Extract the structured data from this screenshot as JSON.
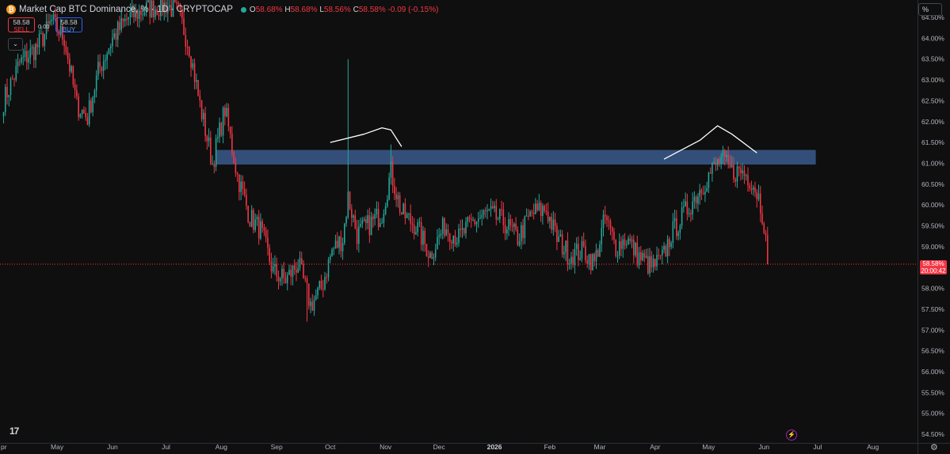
{
  "legend": {
    "coin_icon": "bitcoin-icon",
    "title": "Market Cap BTC Dominance, % · 1D · CRYPTOCAP",
    "open_label": "O",
    "open": "58.68%",
    "high_label": "H",
    "high": "58.68%",
    "low_label": "L",
    "low": "58.56%",
    "close_label": "C",
    "close": "58.58%",
    "change": "-0.09 (-0.15%)"
  },
  "trade": {
    "sell_price": "58.58",
    "sell_label": "SELL",
    "spread": "0.00",
    "buy_price": "58.58",
    "buy_label": "BUY"
  },
  "scale_button": "%",
  "last_price": {
    "value": "58.58%",
    "countdown": "20:00:42"
  },
  "colors": {
    "up": "#26a69a",
    "down": "#f23645",
    "zone": "#3a5a8c",
    "background": "#0f0f0f"
  },
  "chart_data": {
    "type": "candlestick",
    "title": "Market Cap BTC Dominance, % · 1D · CRYPTOCAP",
    "ylim": [
      54.3,
      64.5
    ],
    "y_ticks": [
      "54.50%",
      "55.00%",
      "55.50%",
      "56.00%",
      "56.50%",
      "57.00%",
      "57.50%",
      "58.00%",
      "58.50%",
      "59.00%",
      "59.50%",
      "60.00%",
      "60.50%",
      "61.00%",
      "61.50%",
      "62.00%",
      "62.50%",
      "63.00%",
      "63.50%",
      "64.00%",
      "64.50%"
    ],
    "x_ticks": [
      "pr",
      "May",
      "Jun",
      "Jul",
      "Aug",
      "Sep",
      "Oct",
      "Nov",
      "Dec",
      "2026",
      "Feb",
      "Mar",
      "Apr",
      "May",
      "Jun",
      "Jul",
      "Aug"
    ],
    "x_range": [
      "2025-03-30",
      "2026-08-26"
    ],
    "series": [
      {
        "values": [
          {
            "date": "2025-04-01",
            "close": 62.5
          },
          {
            "date": "2025-04-10",
            "close": 63.4
          },
          {
            "date": "2025-04-20",
            "close": 63.8
          },
          {
            "date": "2025-04-28",
            "close": 64.4
          },
          {
            "date": "2025-05-05",
            "close": 64.0
          },
          {
            "date": "2025-05-12",
            "close": 62.4
          },
          {
            "date": "2025-05-18",
            "close": 62.1
          },
          {
            "date": "2025-05-24",
            "close": 63.2
          },
          {
            "date": "2025-06-01",
            "close": 64.0
          },
          {
            "date": "2025-06-10",
            "close": 64.5
          },
          {
            "date": "2025-06-20",
            "close": 64.7
          },
          {
            "date": "2025-07-01",
            "close": 64.8
          },
          {
            "date": "2025-07-08",
            "close": 64.6
          },
          {
            "date": "2025-07-14",
            "close": 63.8
          },
          {
            "date": "2025-07-20",
            "close": 62.4
          },
          {
            "date": "2025-07-27",
            "close": 61.0
          },
          {
            "date": "2025-08-03",
            "close": 62.3
          },
          {
            "date": "2025-08-10",
            "close": 60.7
          },
          {
            "date": "2025-08-17",
            "close": 59.7
          },
          {
            "date": "2025-08-23",
            "close": 59.4
          },
          {
            "date": "2025-08-30",
            "close": 58.4
          },
          {
            "date": "2025-09-06",
            "close": 58.2
          },
          {
            "date": "2025-09-13",
            "close": 58.6
          },
          {
            "date": "2025-09-20",
            "close": 57.6
          },
          {
            "date": "2025-09-26",
            "close": 58.0
          },
          {
            "date": "2025-10-02",
            "close": 58.9
          },
          {
            "date": "2025-10-08",
            "close": 59.2
          },
          {
            "date": "2025-10-11",
            "close": 60.2
          },
          {
            "date": "2025-10-16",
            "close": 59.3
          },
          {
            "date": "2025-10-22",
            "close": 59.5
          },
          {
            "date": "2025-10-30",
            "close": 59.8
          },
          {
            "date": "2025-11-04",
            "close": 60.8
          },
          {
            "date": "2025-11-10",
            "close": 59.8
          },
          {
            "date": "2025-11-18",
            "close": 59.5
          },
          {
            "date": "2025-11-26",
            "close": 58.8
          },
          {
            "date": "2025-12-04",
            "close": 59.5
          },
          {
            "date": "2025-12-12",
            "close": 59.2
          },
          {
            "date": "2025-12-20",
            "close": 59.6
          },
          {
            "date": "2025-12-28",
            "close": 59.8
          },
          {
            "date": "2026-01-06",
            "close": 59.6
          },
          {
            "date": "2026-01-14",
            "close": 59.2
          },
          {
            "date": "2026-01-22",
            "close": 59.8
          },
          {
            "date": "2026-01-30",
            "close": 59.9
          },
          {
            "date": "2026-02-05",
            "close": 59.2
          },
          {
            "date": "2026-02-12",
            "close": 58.8
          },
          {
            "date": "2026-02-20",
            "close": 58.9
          },
          {
            "date": "2026-02-26",
            "close": 58.6
          },
          {
            "date": "2026-03-04",
            "close": 59.7
          },
          {
            "date": "2026-03-10",
            "close": 59.0
          },
          {
            "date": "2026-03-16",
            "close": 59.2
          },
          {
            "date": "2026-03-22",
            "close": 58.8
          },
          {
            "date": "2026-03-30",
            "close": 58.5
          },
          {
            "date": "2026-04-05",
            "close": 58.7
          },
          {
            "date": "2026-04-10",
            "close": 59.3
          },
          {
            "date": "2026-04-16",
            "close": 59.7
          },
          {
            "date": "2026-04-22",
            "close": 60.1
          },
          {
            "date": "2026-04-28",
            "close": 60.5
          },
          {
            "date": "2026-05-04",
            "close": 60.9
          },
          {
            "date": "2026-05-08",
            "close": 61.1
          },
          {
            "date": "2026-05-14",
            "close": 60.8
          },
          {
            "date": "2026-05-20",
            "close": 60.8
          },
          {
            "date": "2026-05-25",
            "close": 60.6
          },
          {
            "date": "2026-05-29",
            "close": 60.2
          },
          {
            "date": "2026-06-01",
            "close": 59.6
          },
          {
            "date": "2026-06-03",
            "close": 58.58
          }
        ]
      }
    ],
    "annotations": [
      {
        "type": "resistance_zone",
        "ymin": 60.97,
        "ymax": 61.32,
        "x_from": "2025-07-29",
        "x_to": "2026-06-30"
      },
      {
        "type": "arc_sketch",
        "near": "2025-11"
      },
      {
        "type": "arc_sketch",
        "near": "2026-05"
      }
    ],
    "last_price_line": 58.58
  }
}
